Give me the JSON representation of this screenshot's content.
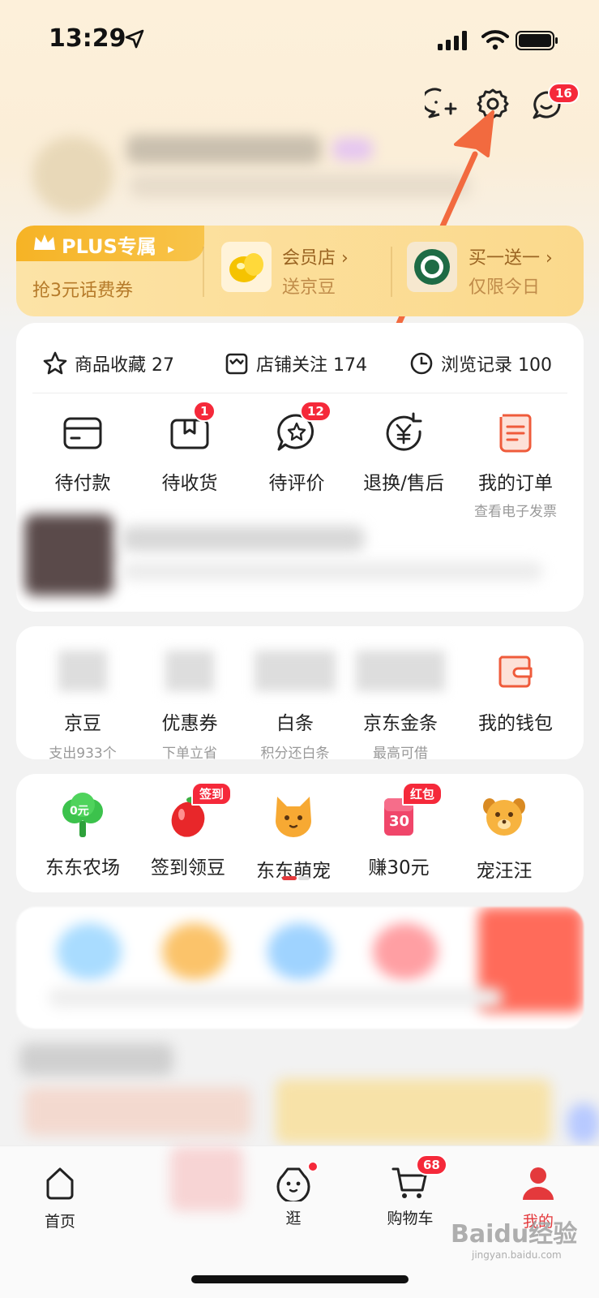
{
  "status_bar": {
    "time": "13:29"
  },
  "header": {
    "messages_badge": "16"
  },
  "plus": {
    "tag": "PLUS专属",
    "tag_arrow": "▸",
    "tag_sub": "抢3元话费券",
    "items": [
      {
        "title": "会员店 ›",
        "sub": "送京豆"
      },
      {
        "title": "买一送一 ›",
        "sub": "仅限今日"
      }
    ]
  },
  "stats": [
    {
      "label": "商品收藏 27",
      "icon": "star-icon"
    },
    {
      "label": "店铺关注 174",
      "icon": "store-icon"
    },
    {
      "label": "浏览记录 100",
      "icon": "clock-icon"
    }
  ],
  "orders": [
    {
      "label": "待付款",
      "icon": "card-icon",
      "badge": ""
    },
    {
      "label": "待收货",
      "icon": "package-icon",
      "badge": "1"
    },
    {
      "label": "待评价",
      "icon": "review-icon",
      "badge": "12"
    },
    {
      "label": "退换/售后",
      "icon": "refund-icon",
      "badge": ""
    },
    {
      "label": "我的订单",
      "icon": "order-list-icon",
      "sub": "查看电子发票"
    }
  ],
  "wallet": [
    {
      "label": "京豆",
      "sub": "支出933个"
    },
    {
      "label": "优惠券",
      "sub": "下单立省"
    },
    {
      "label": "白条",
      "sub": "积分还白条"
    },
    {
      "label": "京东金条",
      "sub": "最高可借"
    },
    {
      "label": "我的钱包",
      "sub": ""
    }
  ],
  "games": [
    {
      "label": "东东农场",
      "icon": "farm-tree-icon",
      "badge": "",
      "icon_text": "0元"
    },
    {
      "label": "签到领豆",
      "icon": "bean-icon",
      "badge": "签到"
    },
    {
      "label": "东东萌宠",
      "icon": "cat-icon",
      "badge": ""
    },
    {
      "label": "赚30元",
      "icon": "red-envelope-icon",
      "badge": "红包",
      "icon_text": "30"
    },
    {
      "label": "宠汪汪",
      "icon": "dog-icon",
      "badge": ""
    }
  ],
  "tabbar": [
    {
      "label": "首页",
      "icon": "home-icon",
      "active": false
    },
    {
      "label": "逛",
      "icon": "explore-face-icon",
      "active": false
    },
    {
      "label": "购物车",
      "icon": "cart-icon",
      "active": false,
      "badge": "68"
    },
    {
      "label": "我的",
      "icon": "profile-icon",
      "active": true
    }
  ],
  "watermark": {
    "text": "Baidu经验",
    "sub": "jingyan.baidu.com"
  },
  "colors": {
    "accent": "#f5293a",
    "annotation_arrow": "#f26a3f",
    "active_tab": "#e4393c",
    "plus_gold": "#f6b325"
  }
}
